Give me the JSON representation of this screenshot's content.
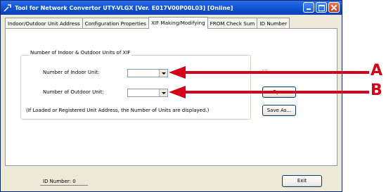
{
  "window": {
    "title": "Tool for Network Convertor UTY-VLGX [Ver. E017V00P00L03] [Online]"
  },
  "tabs": [
    {
      "label": "Indoor/Outdoor Unit Address",
      "active": false
    },
    {
      "label": "Configuration Properties",
      "active": false
    },
    {
      "label": "XIF Making/Modifying",
      "active": true
    },
    {
      "label": "FROM Check Sum",
      "active": false
    },
    {
      "label": "ID Number",
      "active": false
    }
  ],
  "group": {
    "title": "Number of Indoor & Outdoor Units of XIF",
    "indoor_label": "Number of Indoor Unit:",
    "indoor_value": "",
    "outdoor_label": "Number of Outdoor Unit:",
    "outdoor_value": "",
    "note": "(If Loaded or Registered Unit Address, the Number of Units are displayed.)"
  },
  "right": {
    "ghost_text": "XIF",
    "open_label": "Open",
    "save_as_label": "Save As..."
  },
  "footer": {
    "id_number_label": "ID Number:  0",
    "exit_label": "Exit"
  },
  "annotations": {
    "a": "A",
    "b": "B",
    "color": "#d4001a"
  }
}
